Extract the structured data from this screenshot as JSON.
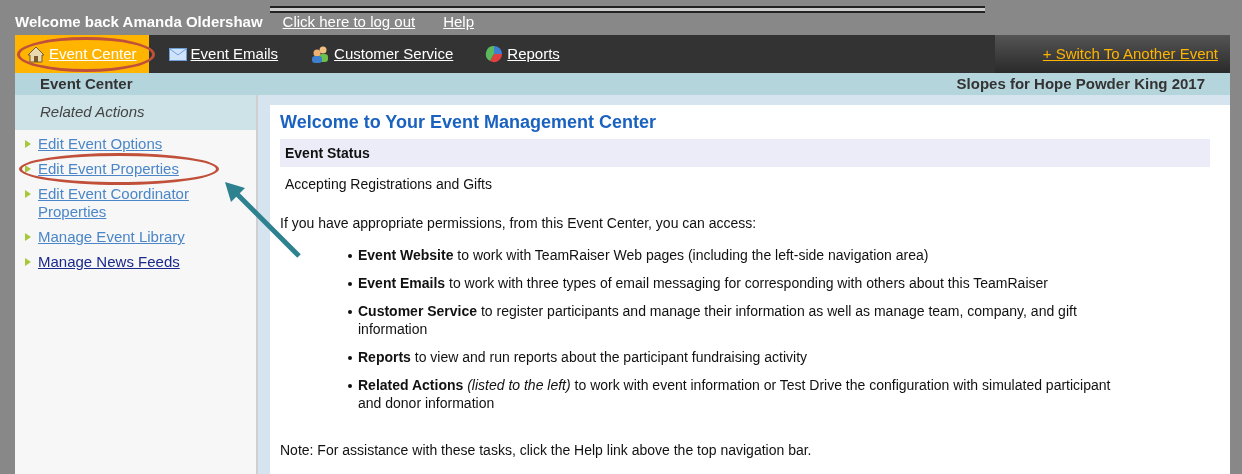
{
  "top_bar": {
    "welcome": "Welcome back Amanda Oldershaw",
    "links": [
      "Click here to log out",
      "Help"
    ]
  },
  "nav": {
    "items": [
      {
        "label": "Event Center",
        "selected": true,
        "circled": true
      },
      {
        "label": "Event Emails",
        "selected": false,
        "circled": false
      },
      {
        "label": "Customer Service",
        "selected": false,
        "circled": false
      },
      {
        "label": "Reports",
        "selected": false,
        "circled": false
      }
    ],
    "switch_link": "+ Switch To Another Event"
  },
  "header": {
    "title": "Event Center",
    "event_name": "Slopes for Hope Powder King 2017"
  },
  "sidebar": {
    "title": "Related Actions",
    "items": [
      {
        "label": "Edit Event Options",
        "visited": false,
        "circled": false
      },
      {
        "label": "Edit Event Properties",
        "visited": false,
        "circled": true
      },
      {
        "label": "Edit Event Coordinator Properties",
        "visited": false,
        "circled": false
      },
      {
        "label": "Manage Event Library",
        "visited": false,
        "circled": false
      },
      {
        "label": "Manage News Feeds",
        "visited": true,
        "circled": false
      }
    ]
  },
  "main": {
    "heading": "Welcome to Your Event Management Center",
    "status_label": "Event Status",
    "status_value": "Accepting Registrations and Gifts",
    "intro": "If you have appropriate permissions, from this Event Center, you can access:",
    "bullets": [
      "**Event Website** to work with TeamRaiser Web pages (including the left-side navigation area)",
      "**Event Emails** to work with three types of email messaging for corresponding with others about this TeamRaiser",
      "**Customer Service** to register participants and manage their information as well as manage team, company, and gift information",
      "**Reports** to view and run reports about the participant fundraising activity",
      "**Related Actions** *(listed to the left)* to work with event information or Test Drive the configuration with simulated participant and donor information"
    ],
    "note": "Note: For assistance with these tasks, click the Help link above the top navigation bar."
  }
}
